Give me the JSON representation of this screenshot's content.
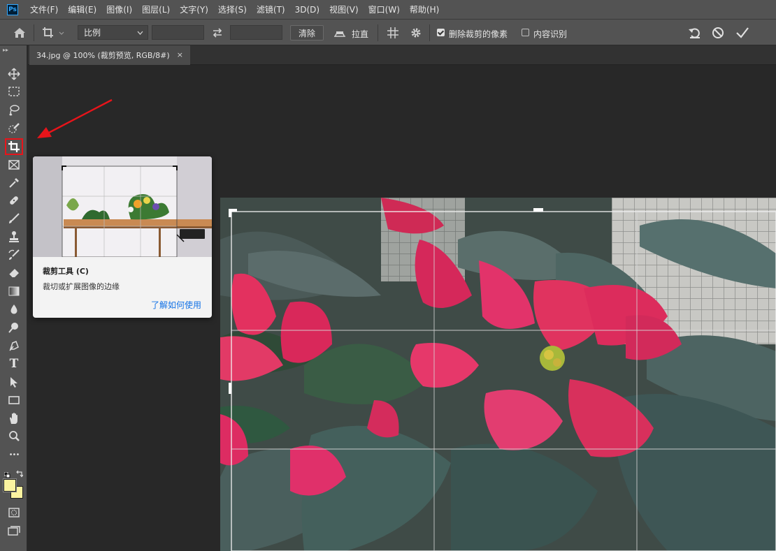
{
  "app": {
    "logo": "Ps"
  },
  "menu": [
    "文件(F)",
    "编辑(E)",
    "图像(I)",
    "图层(L)",
    "文字(Y)",
    "选择(S)",
    "滤镜(T)",
    "3D(D)",
    "视图(V)",
    "窗口(W)",
    "帮助(H)"
  ],
  "options": {
    "ratio_value": "比例",
    "width_value": "",
    "height_value": "",
    "clear_label": "清除",
    "straighten_label": "拉直",
    "delete_cropped": {
      "label": "删除裁剪的像素",
      "checked": true
    },
    "content_aware": {
      "label": "内容识别",
      "checked": false
    }
  },
  "document_tab": {
    "title": "34.jpg @ 100% (裁剪预览, RGB/8#)",
    "close": "×"
  },
  "tools": [
    "move-tool",
    "marquee-tool",
    "lasso-tool",
    "quick-select-tool",
    "crop-tool",
    "frame-tool",
    "eyedropper-tool",
    "healing-brush-tool",
    "brush-tool",
    "clone-stamp-tool",
    "history-brush-tool",
    "eraser-tool",
    "gradient-tool",
    "blur-tool",
    "dodge-tool",
    "pen-tool",
    "type-tool",
    "path-select-tool",
    "rectangle-tool",
    "hand-tool",
    "zoom-tool",
    "more-tools"
  ],
  "toolbar": {
    "type_glyph": "T",
    "more_glyph": "•••"
  },
  "colors": {
    "foreground": "#fbf3a0",
    "background": "#fbf3a0",
    "accent_highlight": "#e8141a",
    "link": "#1473e6"
  },
  "tooltip": {
    "title": "裁剪工具 (C)",
    "description": "裁切或扩展图像的边缘",
    "link": "了解如何使用"
  }
}
